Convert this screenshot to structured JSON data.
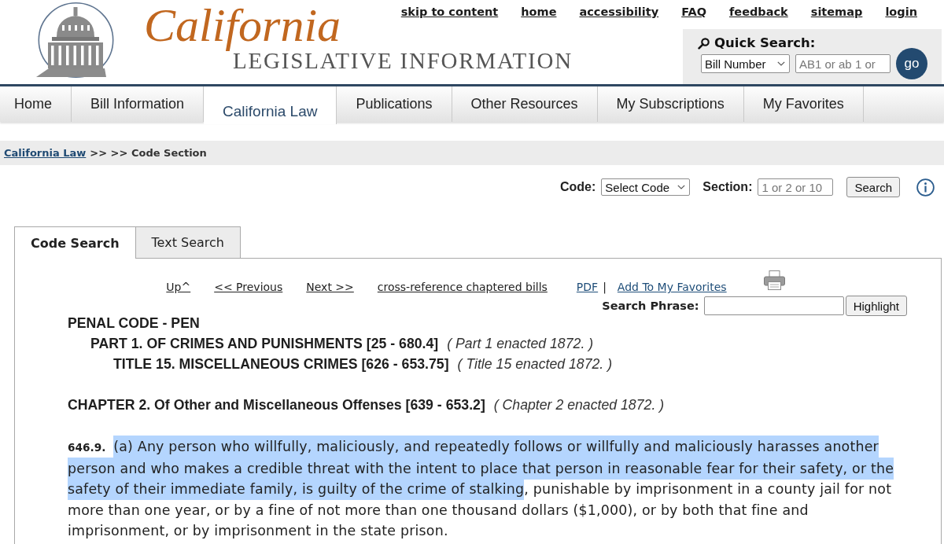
{
  "header": {
    "logo_title": "California",
    "logo_subtitle": "LEGISLATIVE INFORMATION",
    "links": [
      "skip to content",
      "home",
      "accessibility",
      "FAQ",
      "feedback",
      "sitemap",
      "login"
    ],
    "quick_search": {
      "title": "Quick Search:",
      "type_select": "Bill Number",
      "placeholder": "AB1 or ab 1 or",
      "button": "go"
    }
  },
  "nav_tabs": [
    {
      "label": "Home",
      "selected": false
    },
    {
      "label": "Bill Information",
      "selected": false
    },
    {
      "label": "California Law",
      "selected": true
    },
    {
      "label": "Publications",
      "selected": false
    },
    {
      "label": "Other Resources",
      "selected": false
    },
    {
      "label": "My Subscriptions",
      "selected": false
    },
    {
      "label": "My Favorites",
      "selected": false
    }
  ],
  "breadcrumb": {
    "link": "California Law",
    "trail": ">> >> Code Section"
  },
  "code_search": {
    "code_label": "Code:",
    "code_select": "Select Code",
    "section_label": "Section:",
    "section_placeholder": "1 or 2 or 10",
    "button": "Search"
  },
  "search_tabs": [
    {
      "label": "Code Search",
      "selected": true
    },
    {
      "label": "Text Search",
      "selected": false
    }
  ],
  "toolbar": [
    {
      "kind": "nav",
      "label": "Up^"
    },
    {
      "kind": "nav",
      "label": "<< Previous"
    },
    {
      "kind": "nav",
      "label": "Next >>"
    },
    {
      "kind": "nav",
      "label": "cross-reference chaptered bills"
    },
    {
      "kind": "action",
      "label": "PDF"
    },
    {
      "kind": "separator",
      "label": "|"
    },
    {
      "kind": "action",
      "label": "Add To My Favorites"
    }
  ],
  "search_phrase": {
    "label": "Search Phrase:",
    "button": "Highlight"
  },
  "outline": [
    {
      "title": "PENAL CODE - PEN",
      "children": [
        {
          "title": "PART 1. OF CRIMES AND PUNISHMENTS [25 - 680.4]",
          "note": "( Part 1 enacted 1872. )",
          "children": [
            {
              "title": "TITLE 15. MISCELLANEOUS CRIMES [626 - 653.75]",
              "note": "( Title 15 enacted 1872. )"
            }
          ]
        }
      ]
    }
  ],
  "chapter": {
    "title": "CHAPTER 2. Of Other and Miscellaneous Offenses [639 - 653.2]",
    "note": "( Chapter 2 enacted 1872. )"
  },
  "section": {
    "number": "646.9.",
    "segments": [
      {
        "text": "(a) Any person who willfully, maliciously, and repeatedly follows or willfully and maliciously harasses another person and who makes a credible threat with the intent to place that person in reasonable fear for their safety, or the safety of their immediate family, is guilty of the crime of stalking",
        "selected": true
      },
      {
        "text": ", punishable by imprisonment in a county jail for not more than one year, or by a fine of not more than one thousand dollars ($1,000), or by both that fine and imprisonment, or by imprisonment in the state prison.",
        "selected": false
      }
    ]
  }
}
